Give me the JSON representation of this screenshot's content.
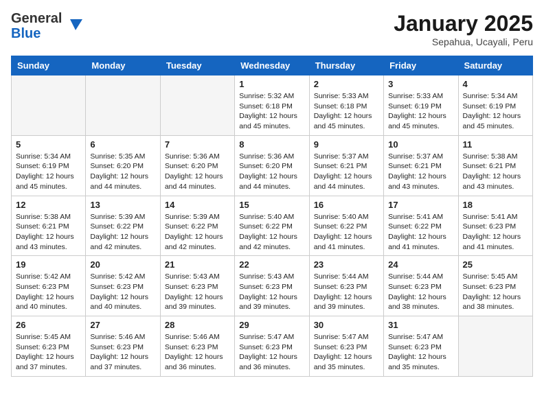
{
  "header": {
    "logo_general": "General",
    "logo_blue": "Blue",
    "month": "January 2025",
    "location": "Sepahua, Ucayali, Peru"
  },
  "days_of_week": [
    "Sunday",
    "Monday",
    "Tuesday",
    "Wednesday",
    "Thursday",
    "Friday",
    "Saturday"
  ],
  "weeks": [
    [
      {
        "day": "",
        "info": ""
      },
      {
        "day": "",
        "info": ""
      },
      {
        "day": "",
        "info": ""
      },
      {
        "day": "1",
        "info": "Sunrise: 5:32 AM\nSunset: 6:18 PM\nDaylight: 12 hours\nand 45 minutes."
      },
      {
        "day": "2",
        "info": "Sunrise: 5:33 AM\nSunset: 6:18 PM\nDaylight: 12 hours\nand 45 minutes."
      },
      {
        "day": "3",
        "info": "Sunrise: 5:33 AM\nSunset: 6:19 PM\nDaylight: 12 hours\nand 45 minutes."
      },
      {
        "day": "4",
        "info": "Sunrise: 5:34 AM\nSunset: 6:19 PM\nDaylight: 12 hours\nand 45 minutes."
      }
    ],
    [
      {
        "day": "5",
        "info": "Sunrise: 5:34 AM\nSunset: 6:19 PM\nDaylight: 12 hours\nand 45 minutes."
      },
      {
        "day": "6",
        "info": "Sunrise: 5:35 AM\nSunset: 6:20 PM\nDaylight: 12 hours\nand 44 minutes."
      },
      {
        "day": "7",
        "info": "Sunrise: 5:36 AM\nSunset: 6:20 PM\nDaylight: 12 hours\nand 44 minutes."
      },
      {
        "day": "8",
        "info": "Sunrise: 5:36 AM\nSunset: 6:20 PM\nDaylight: 12 hours\nand 44 minutes."
      },
      {
        "day": "9",
        "info": "Sunrise: 5:37 AM\nSunset: 6:21 PM\nDaylight: 12 hours\nand 44 minutes."
      },
      {
        "day": "10",
        "info": "Sunrise: 5:37 AM\nSunset: 6:21 PM\nDaylight: 12 hours\nand 43 minutes."
      },
      {
        "day": "11",
        "info": "Sunrise: 5:38 AM\nSunset: 6:21 PM\nDaylight: 12 hours\nand 43 minutes."
      }
    ],
    [
      {
        "day": "12",
        "info": "Sunrise: 5:38 AM\nSunset: 6:21 PM\nDaylight: 12 hours\nand 43 minutes."
      },
      {
        "day": "13",
        "info": "Sunrise: 5:39 AM\nSunset: 6:22 PM\nDaylight: 12 hours\nand 42 minutes."
      },
      {
        "day": "14",
        "info": "Sunrise: 5:39 AM\nSunset: 6:22 PM\nDaylight: 12 hours\nand 42 minutes."
      },
      {
        "day": "15",
        "info": "Sunrise: 5:40 AM\nSunset: 6:22 PM\nDaylight: 12 hours\nand 42 minutes."
      },
      {
        "day": "16",
        "info": "Sunrise: 5:40 AM\nSunset: 6:22 PM\nDaylight: 12 hours\nand 41 minutes."
      },
      {
        "day": "17",
        "info": "Sunrise: 5:41 AM\nSunset: 6:22 PM\nDaylight: 12 hours\nand 41 minutes."
      },
      {
        "day": "18",
        "info": "Sunrise: 5:41 AM\nSunset: 6:23 PM\nDaylight: 12 hours\nand 41 minutes."
      }
    ],
    [
      {
        "day": "19",
        "info": "Sunrise: 5:42 AM\nSunset: 6:23 PM\nDaylight: 12 hours\nand 40 minutes."
      },
      {
        "day": "20",
        "info": "Sunrise: 5:42 AM\nSunset: 6:23 PM\nDaylight: 12 hours\nand 40 minutes."
      },
      {
        "day": "21",
        "info": "Sunrise: 5:43 AM\nSunset: 6:23 PM\nDaylight: 12 hours\nand 39 minutes."
      },
      {
        "day": "22",
        "info": "Sunrise: 5:43 AM\nSunset: 6:23 PM\nDaylight: 12 hours\nand 39 minutes."
      },
      {
        "day": "23",
        "info": "Sunrise: 5:44 AM\nSunset: 6:23 PM\nDaylight: 12 hours\nand 39 minutes."
      },
      {
        "day": "24",
        "info": "Sunrise: 5:44 AM\nSunset: 6:23 PM\nDaylight: 12 hours\nand 38 minutes."
      },
      {
        "day": "25",
        "info": "Sunrise: 5:45 AM\nSunset: 6:23 PM\nDaylight: 12 hours\nand 38 minutes."
      }
    ],
    [
      {
        "day": "26",
        "info": "Sunrise: 5:45 AM\nSunset: 6:23 PM\nDaylight: 12 hours\nand 37 minutes."
      },
      {
        "day": "27",
        "info": "Sunrise: 5:46 AM\nSunset: 6:23 PM\nDaylight: 12 hours\nand 37 minutes."
      },
      {
        "day": "28",
        "info": "Sunrise: 5:46 AM\nSunset: 6:23 PM\nDaylight: 12 hours\nand 36 minutes."
      },
      {
        "day": "29",
        "info": "Sunrise: 5:47 AM\nSunset: 6:23 PM\nDaylight: 12 hours\nand 36 minutes."
      },
      {
        "day": "30",
        "info": "Sunrise: 5:47 AM\nSunset: 6:23 PM\nDaylight: 12 hours\nand 35 minutes."
      },
      {
        "day": "31",
        "info": "Sunrise: 5:47 AM\nSunset: 6:23 PM\nDaylight: 12 hours\nand 35 minutes."
      },
      {
        "day": "",
        "info": ""
      }
    ]
  ]
}
